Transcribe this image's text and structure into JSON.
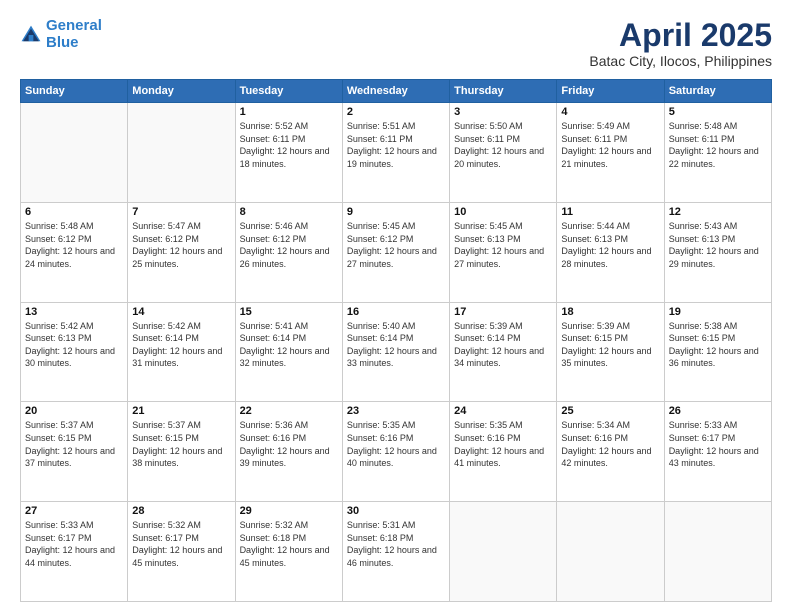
{
  "logo": {
    "line1": "General",
    "line2": "Blue"
  },
  "title": "April 2025",
  "subtitle": "Batac City, Ilocos, Philippines",
  "days_header": [
    "Sunday",
    "Monday",
    "Tuesday",
    "Wednesday",
    "Thursday",
    "Friday",
    "Saturday"
  ],
  "weeks": [
    [
      {
        "day": "",
        "sunrise": "",
        "sunset": "",
        "daylight": ""
      },
      {
        "day": "",
        "sunrise": "",
        "sunset": "",
        "daylight": ""
      },
      {
        "day": "1",
        "sunrise": "Sunrise: 5:52 AM",
        "sunset": "Sunset: 6:11 PM",
        "daylight": "Daylight: 12 hours and 18 minutes."
      },
      {
        "day": "2",
        "sunrise": "Sunrise: 5:51 AM",
        "sunset": "Sunset: 6:11 PM",
        "daylight": "Daylight: 12 hours and 19 minutes."
      },
      {
        "day": "3",
        "sunrise": "Sunrise: 5:50 AM",
        "sunset": "Sunset: 6:11 PM",
        "daylight": "Daylight: 12 hours and 20 minutes."
      },
      {
        "day": "4",
        "sunrise": "Sunrise: 5:49 AM",
        "sunset": "Sunset: 6:11 PM",
        "daylight": "Daylight: 12 hours and 21 minutes."
      },
      {
        "day": "5",
        "sunrise": "Sunrise: 5:48 AM",
        "sunset": "Sunset: 6:11 PM",
        "daylight": "Daylight: 12 hours and 22 minutes."
      }
    ],
    [
      {
        "day": "6",
        "sunrise": "Sunrise: 5:48 AM",
        "sunset": "Sunset: 6:12 PM",
        "daylight": "Daylight: 12 hours and 24 minutes."
      },
      {
        "day": "7",
        "sunrise": "Sunrise: 5:47 AM",
        "sunset": "Sunset: 6:12 PM",
        "daylight": "Daylight: 12 hours and 25 minutes."
      },
      {
        "day": "8",
        "sunrise": "Sunrise: 5:46 AM",
        "sunset": "Sunset: 6:12 PM",
        "daylight": "Daylight: 12 hours and 26 minutes."
      },
      {
        "day": "9",
        "sunrise": "Sunrise: 5:45 AM",
        "sunset": "Sunset: 6:12 PM",
        "daylight": "Daylight: 12 hours and 27 minutes."
      },
      {
        "day": "10",
        "sunrise": "Sunrise: 5:45 AM",
        "sunset": "Sunset: 6:13 PM",
        "daylight": "Daylight: 12 hours and 27 minutes."
      },
      {
        "day": "11",
        "sunrise": "Sunrise: 5:44 AM",
        "sunset": "Sunset: 6:13 PM",
        "daylight": "Daylight: 12 hours and 28 minutes."
      },
      {
        "day": "12",
        "sunrise": "Sunrise: 5:43 AM",
        "sunset": "Sunset: 6:13 PM",
        "daylight": "Daylight: 12 hours and 29 minutes."
      }
    ],
    [
      {
        "day": "13",
        "sunrise": "Sunrise: 5:42 AM",
        "sunset": "Sunset: 6:13 PM",
        "daylight": "Daylight: 12 hours and 30 minutes."
      },
      {
        "day": "14",
        "sunrise": "Sunrise: 5:42 AM",
        "sunset": "Sunset: 6:14 PM",
        "daylight": "Daylight: 12 hours and 31 minutes."
      },
      {
        "day": "15",
        "sunrise": "Sunrise: 5:41 AM",
        "sunset": "Sunset: 6:14 PM",
        "daylight": "Daylight: 12 hours and 32 minutes."
      },
      {
        "day": "16",
        "sunrise": "Sunrise: 5:40 AM",
        "sunset": "Sunset: 6:14 PM",
        "daylight": "Daylight: 12 hours and 33 minutes."
      },
      {
        "day": "17",
        "sunrise": "Sunrise: 5:39 AM",
        "sunset": "Sunset: 6:14 PM",
        "daylight": "Daylight: 12 hours and 34 minutes."
      },
      {
        "day": "18",
        "sunrise": "Sunrise: 5:39 AM",
        "sunset": "Sunset: 6:15 PM",
        "daylight": "Daylight: 12 hours and 35 minutes."
      },
      {
        "day": "19",
        "sunrise": "Sunrise: 5:38 AM",
        "sunset": "Sunset: 6:15 PM",
        "daylight": "Daylight: 12 hours and 36 minutes."
      }
    ],
    [
      {
        "day": "20",
        "sunrise": "Sunrise: 5:37 AM",
        "sunset": "Sunset: 6:15 PM",
        "daylight": "Daylight: 12 hours and 37 minutes."
      },
      {
        "day": "21",
        "sunrise": "Sunrise: 5:37 AM",
        "sunset": "Sunset: 6:15 PM",
        "daylight": "Daylight: 12 hours and 38 minutes."
      },
      {
        "day": "22",
        "sunrise": "Sunrise: 5:36 AM",
        "sunset": "Sunset: 6:16 PM",
        "daylight": "Daylight: 12 hours and 39 minutes."
      },
      {
        "day": "23",
        "sunrise": "Sunrise: 5:35 AM",
        "sunset": "Sunset: 6:16 PM",
        "daylight": "Daylight: 12 hours and 40 minutes."
      },
      {
        "day": "24",
        "sunrise": "Sunrise: 5:35 AM",
        "sunset": "Sunset: 6:16 PM",
        "daylight": "Daylight: 12 hours and 41 minutes."
      },
      {
        "day": "25",
        "sunrise": "Sunrise: 5:34 AM",
        "sunset": "Sunset: 6:16 PM",
        "daylight": "Daylight: 12 hours and 42 minutes."
      },
      {
        "day": "26",
        "sunrise": "Sunrise: 5:33 AM",
        "sunset": "Sunset: 6:17 PM",
        "daylight": "Daylight: 12 hours and 43 minutes."
      }
    ],
    [
      {
        "day": "27",
        "sunrise": "Sunrise: 5:33 AM",
        "sunset": "Sunset: 6:17 PM",
        "daylight": "Daylight: 12 hours and 44 minutes."
      },
      {
        "day": "28",
        "sunrise": "Sunrise: 5:32 AM",
        "sunset": "Sunset: 6:17 PM",
        "daylight": "Daylight: 12 hours and 45 minutes."
      },
      {
        "day": "29",
        "sunrise": "Sunrise: 5:32 AM",
        "sunset": "Sunset: 6:18 PM",
        "daylight": "Daylight: 12 hours and 45 minutes."
      },
      {
        "day": "30",
        "sunrise": "Sunrise: 5:31 AM",
        "sunset": "Sunset: 6:18 PM",
        "daylight": "Daylight: 12 hours and 46 minutes."
      },
      {
        "day": "",
        "sunrise": "",
        "sunset": "",
        "daylight": ""
      },
      {
        "day": "",
        "sunrise": "",
        "sunset": "",
        "daylight": ""
      },
      {
        "day": "",
        "sunrise": "",
        "sunset": "",
        "daylight": ""
      }
    ]
  ]
}
